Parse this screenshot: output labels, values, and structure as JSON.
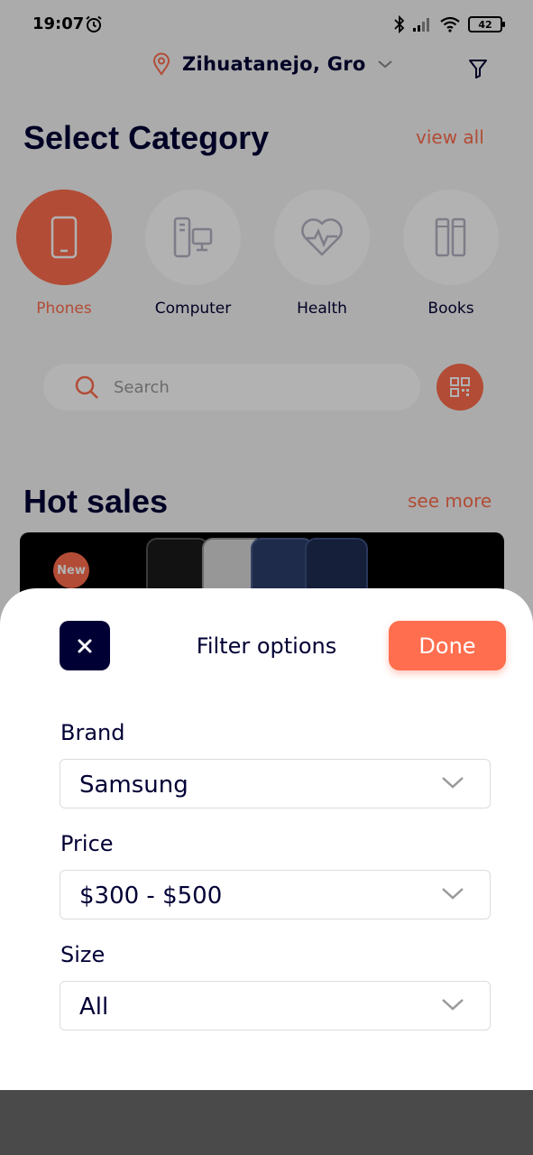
{
  "status_bar": {
    "time": "19:07",
    "battery": "42"
  },
  "header": {
    "location": "Zihuatanejo, Gro"
  },
  "categories_section": {
    "title": "Select Category",
    "link": "view all",
    "items": [
      {
        "label": "Phones",
        "icon": "phone-icon",
        "active": true
      },
      {
        "label": "Computer",
        "icon": "computer-icon",
        "active": false
      },
      {
        "label": "Health",
        "icon": "health-icon",
        "active": false
      },
      {
        "label": "Books",
        "icon": "books-icon",
        "active": false
      }
    ]
  },
  "search": {
    "placeholder": "Search"
  },
  "hot_sales": {
    "title": "Hot sales",
    "link": "see more",
    "badge": "New"
  },
  "filter_sheet": {
    "title": "Filter options",
    "done_label": "Done",
    "fields": [
      {
        "label": "Brand",
        "value": "Samsung"
      },
      {
        "label": "Price",
        "value": "$300 - $500"
      },
      {
        "label": "Size",
        "value": "All"
      }
    ]
  },
  "colors": {
    "accent": "#FF6E4E",
    "dark": "#010035"
  }
}
